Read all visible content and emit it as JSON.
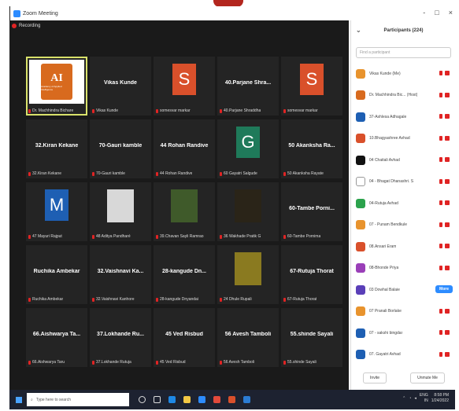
{
  "window": {
    "title": "Zoom Meeting",
    "controls": [
      "-",
      "□",
      "×"
    ]
  },
  "recording": {
    "label": "Recording"
  },
  "tiles": [
    {
      "display": "",
      "label": "Dr. Machhindra Bichare",
      "type": "logo",
      "logo_text": "AI",
      "logo_sub": "Academy of Applied Intelligence",
      "active": true
    },
    {
      "display": "Vikas Kunde",
      "label": "Vikas Kunde",
      "type": "name"
    },
    {
      "display": "S",
      "label": "somesvar markar",
      "type": "letter",
      "color": "#d9502b"
    },
    {
      "display": "40.Parjane Shra...",
      "label": "40.Parjane Shraddha",
      "type": "name"
    },
    {
      "display": "S",
      "label": "somesvar markar",
      "type": "letter",
      "color": "#d9502b"
    },
    {
      "display": "32.Kiran Kekane",
      "label": "32.Kiran Kekane",
      "type": "name"
    },
    {
      "display": "70-Gauri kamble",
      "label": "70-Gauri kamble",
      "type": "name"
    },
    {
      "display": "44 Rohan Randive",
      "label": "44 Rohan Randive",
      "type": "name"
    },
    {
      "display": "G",
      "label": "60 Gayatri Salgude",
      "type": "letter",
      "color": "#1f7a5a"
    },
    {
      "display": "50 Akanksha Ra...",
      "label": "50 Akanksha Rayate",
      "type": "name"
    },
    {
      "display": "M",
      "label": "47 Mayuri Rajput",
      "type": "letter",
      "color": "#1e5fb3"
    },
    {
      "display": "",
      "label": "48 Aditya Pandharé",
      "type": "photo",
      "color": "#d8d8d8"
    },
    {
      "display": "",
      "label": "39.Chavan Sayli Ramrao",
      "type": "photo",
      "color": "#3f5a2a"
    },
    {
      "display": "",
      "label": "36 Wakhade Pratik G",
      "type": "photo",
      "color": "#2a2418"
    },
    {
      "display": "60-Tambe Porni...",
      "label": "60-Tambe Pornima",
      "type": "name"
    },
    {
      "display": "Ruchika Ambekar",
      "label": "Ruchika Ambekar",
      "type": "name"
    },
    {
      "display": "32.Vaishnavi Ka...",
      "label": "32.Vaishnavi Kanhore",
      "type": "name"
    },
    {
      "display": "28-kangude Dn...",
      "label": "28-kangude Dnyandai",
      "type": "name"
    },
    {
      "display": "",
      "label": "24 Dhule Rupali",
      "type": "photo",
      "color": "#8a7a20"
    },
    {
      "display": "67-Rutuja Thorat",
      "label": "67-Rutuja Thorat",
      "type": "name"
    },
    {
      "display": "66.Aishwarya Ta...",
      "label": "66.Aishwarya Taru",
      "type": "name"
    },
    {
      "display": "37.Lokhande Ru...",
      "label": "37.Lokhande Rutuja",
      "type": "name"
    },
    {
      "display": "45 Ved Risbud",
      "label": "45 Ved Risbud",
      "type": "name"
    },
    {
      "display": "56 Avesh Tamboli",
      "label": "56 Avesh Tamboli",
      "type": "name"
    },
    {
      "display": "55.shinde Sayali",
      "label": "55.shinde Sayali",
      "type": "name"
    }
  ],
  "participants_panel": {
    "title": "Participants (224)",
    "search_placeholder": "Find a participant",
    "participants": [
      {
        "name": "Vikas Kunde (Me)",
        "color": "#e8932d"
      },
      {
        "name": "Dr. Machhindra Bic... (Host)",
        "color": "#d86a1e"
      },
      {
        "name": "37-Ashlesa Adhagale",
        "color": "#1e5fb3"
      },
      {
        "name": "10.Bhagyashree Avhad",
        "color": "#d9502b"
      },
      {
        "name": "04 Chaitali Avhad",
        "color": "#111111"
      },
      {
        "name": "04 - Bhagat Dhanashri. S",
        "color": "#ffffff"
      },
      {
        "name": "04-Rutuja Avhad",
        "color": "#2ba24c"
      },
      {
        "name": "07 - Punam Bendkule",
        "color": "#e8932d"
      },
      {
        "name": "08.Ansari Eram",
        "color": "#d9502b"
      },
      {
        "name": "08-Bhonde Priya",
        "color": "#9a3fb8"
      },
      {
        "name": "03 Dowhal Balaie",
        "color": "#5a3fb8"
      },
      {
        "name": "07 Pranali Borlake",
        "color": "#e8932d"
      },
      {
        "name": "07 - sakshi bingdar",
        "color": "#1e5fb3"
      },
      {
        "name": "07. Gayatri Avhad",
        "color": "#1e5fb3"
      }
    ],
    "more_label": "More",
    "invite_label": "Invite",
    "unmute_label": "Unmute Me"
  },
  "taskbar": {
    "search_placeholder": "Type here to search",
    "lang": "ENG",
    "lang_sub": "IN",
    "time": "8:58 PM",
    "date": "1/24/2022"
  }
}
